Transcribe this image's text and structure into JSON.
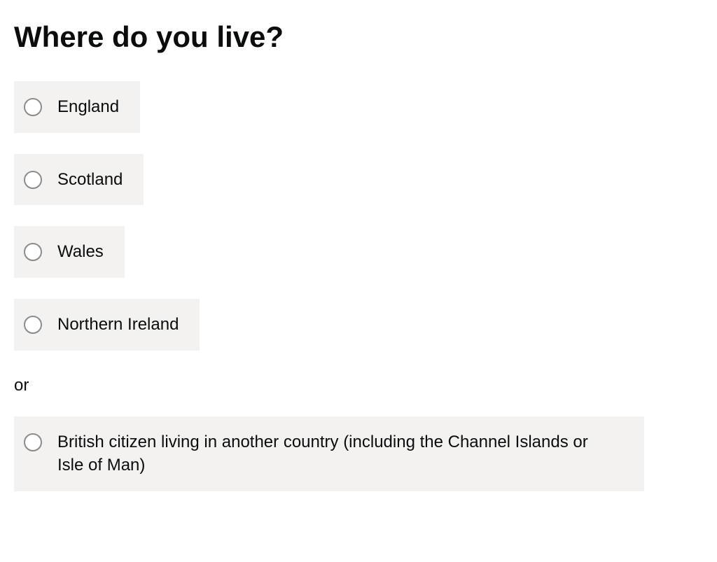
{
  "question": {
    "heading": "Where do you live?",
    "divider": "or",
    "options": [
      {
        "id": "england",
        "label": "England"
      },
      {
        "id": "scotland",
        "label": "Scotland"
      },
      {
        "id": "wales",
        "label": "Wales"
      },
      {
        "id": "northern-ireland",
        "label": "Northern Ireland"
      }
    ],
    "alternate_option": {
      "id": "abroad",
      "label": "British citizen living in another country (including the Channel Islands or Isle of Man)"
    }
  }
}
